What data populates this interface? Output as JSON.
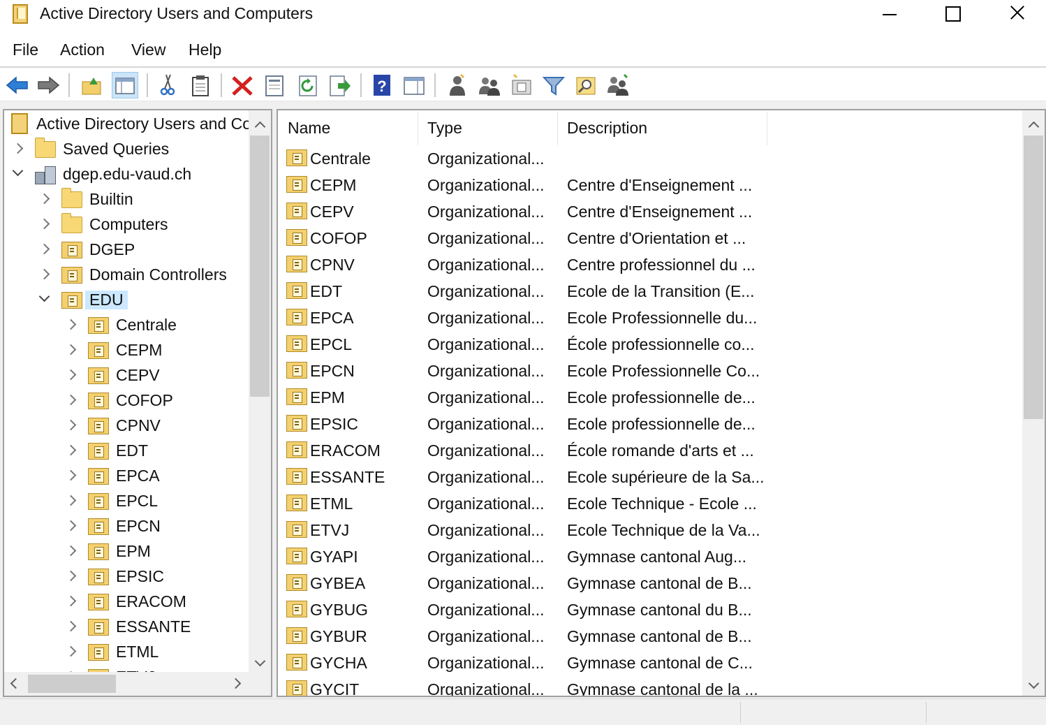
{
  "window": {
    "title": "Active Directory Users and Computers"
  },
  "menu": {
    "items": [
      "File",
      "Action",
      "View",
      "Help"
    ]
  },
  "toolbar": {
    "buttons": [
      {
        "name": "back-icon",
        "color": "#2f7fd6"
      },
      {
        "name": "forward-icon",
        "color": "#6a6a6a"
      },
      {
        "name": "up-folder-icon",
        "color": "#e8b84a"
      },
      {
        "name": "show-hide-console-tree-icon",
        "color": "#5a7ea8"
      },
      {
        "name": "cut-icon",
        "color": "#3a6fb5"
      },
      {
        "name": "copy-icon",
        "color": "#555555"
      },
      {
        "name": "delete-icon",
        "color": "#d42020"
      },
      {
        "name": "properties-icon",
        "color": "#6b7c91"
      },
      {
        "name": "refresh-icon",
        "color": "#2f9a3a"
      },
      {
        "name": "export-list-icon",
        "color": "#3a9a3a"
      },
      {
        "name": "help-icon",
        "color": "#2845a8"
      },
      {
        "name": "show-hide-action-pane-icon",
        "color": "#5a7ea8"
      },
      {
        "name": "new-user-icon",
        "color": "#555555"
      },
      {
        "name": "new-group-icon",
        "color": "#555555"
      },
      {
        "name": "new-ou-icon",
        "color": "#777777"
      },
      {
        "name": "filter-icon",
        "color": "#3a6fb5"
      },
      {
        "name": "find-icon",
        "color": "#e8b84a"
      },
      {
        "name": "add-to-group-icon",
        "color": "#555555"
      }
    ]
  },
  "tree": {
    "root_label": "Active Directory Users and Co",
    "saved_queries": "Saved Queries",
    "domain": "dgep.edu-vaud.ch",
    "domain_children": [
      "Builtin",
      "Computers",
      "DGEP",
      "Domain Controllers",
      "EDU"
    ],
    "selected": "EDU",
    "edu_children": [
      "Centrale",
      "CEPM",
      "CEPV",
      "COFOP",
      "CPNV",
      "EDT",
      "EPCA",
      "EPCL",
      "EPCN",
      "EPM",
      "EPSIC",
      "ERACOM",
      "ESSANTE",
      "ETML",
      "ETVJ"
    ]
  },
  "list": {
    "columns": [
      "Name",
      "Type",
      "Description"
    ],
    "rows": [
      {
        "name": "Centrale",
        "type": "Organizational...",
        "description": ""
      },
      {
        "name": "CEPM",
        "type": "Organizational...",
        "description": "Centre d'Enseignement ..."
      },
      {
        "name": "CEPV",
        "type": "Organizational...",
        "description": "Centre d'Enseignement ..."
      },
      {
        "name": "COFOP",
        "type": "Organizational...",
        "description": "Centre d'Orientation et ..."
      },
      {
        "name": "CPNV",
        "type": "Organizational...",
        "description": "Centre professionnel du ..."
      },
      {
        "name": "EDT",
        "type": "Organizational...",
        "description": "Ecole de la Transition (E..."
      },
      {
        "name": "EPCA",
        "type": "Organizational...",
        "description": "Ecole Professionnelle du..."
      },
      {
        "name": "EPCL",
        "type": "Organizational...",
        "description": "École professionnelle co..."
      },
      {
        "name": "EPCN",
        "type": "Organizational...",
        "description": "Ecole Professionnelle Co..."
      },
      {
        "name": "EPM",
        "type": "Organizational...",
        "description": "Ecole professionnelle de..."
      },
      {
        "name": "EPSIC",
        "type": "Organizational...",
        "description": "Ecole professionnelle de..."
      },
      {
        "name": "ERACOM",
        "type": "Organizational...",
        "description": "École romande d'arts et ..."
      },
      {
        "name": "ESSANTE",
        "type": "Organizational...",
        "description": "Ecole supérieure de la Sa..."
      },
      {
        "name": "ETML",
        "type": "Organizational...",
        "description": "Ecole Technique - Ecole ..."
      },
      {
        "name": "ETVJ",
        "type": "Organizational...",
        "description": "Ecole Technique de la Va..."
      },
      {
        "name": "GYAPI",
        "type": "Organizational...",
        "description": "Gymnase cantonal  Aug..."
      },
      {
        "name": "GYBEA",
        "type": "Organizational...",
        "description": "Gymnase cantonal de B..."
      },
      {
        "name": "GYBUG",
        "type": "Organizational...",
        "description": "Gymnase cantonal du B..."
      },
      {
        "name": "GYBUR",
        "type": "Organizational...",
        "description": "Gymnase cantonal de B..."
      },
      {
        "name": "GYCHA",
        "type": "Organizational...",
        "description": "Gymnase cantonal de C..."
      },
      {
        "name": "GYCIT",
        "type": "Organizational...",
        "description": "Gymnase cantonal de la ..."
      }
    ]
  }
}
